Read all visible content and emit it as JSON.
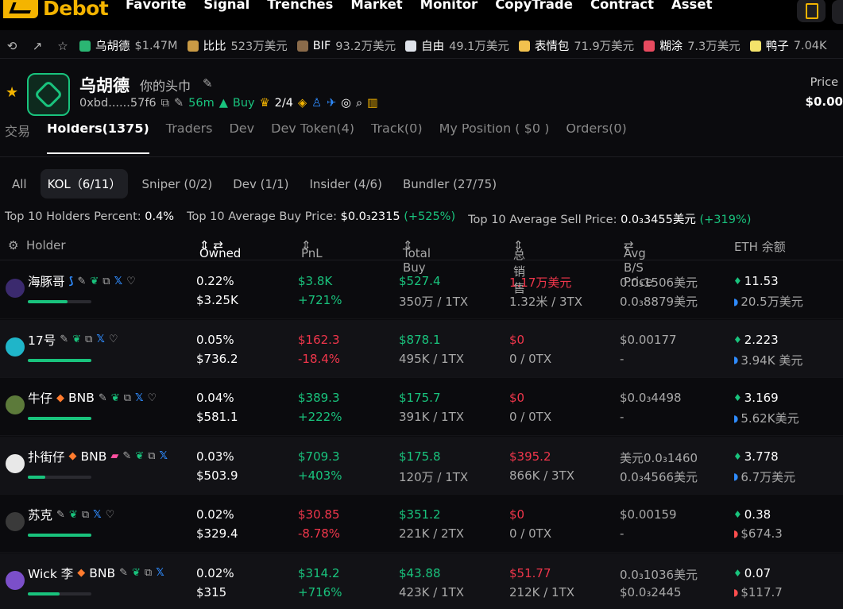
{
  "nav": {
    "logo": "Debot",
    "links": [
      "Favorite",
      "Signal",
      "Trenches",
      "Market",
      "Monitor",
      "CopyTrade",
      "Contract",
      "Asset"
    ]
  },
  "ticker": [
    {
      "name": "乌胡德",
      "value": "$1.47M",
      "color": "#2bb673"
    },
    {
      "name": "比比",
      "value": "523万美元",
      "color": "#c99a45"
    },
    {
      "name": "BIF",
      "value": "93.2万美元",
      "color": "#8a6b4a"
    },
    {
      "name": "自由",
      "value": "49.1万美元",
      "color": "#dfe3ea"
    },
    {
      "name": "表情包",
      "value": "71.9万美元",
      "color": "#f2c14e"
    },
    {
      "name": "糊涂",
      "value": "7.3万美元",
      "color": "#e84a5f"
    },
    {
      "name": "鸭子",
      "value": "7.04K",
      "color": "#f4e36b"
    }
  ],
  "token": {
    "name": "乌胡德",
    "subtitle": "你的头巾",
    "address": "0xbd......57f6",
    "age": "56m",
    "buy_label": "Buy",
    "ratio": "2/4",
    "price_label": "Price",
    "price_value": "$0.00"
  },
  "tabs": [
    "交易",
    "Holders(1375)",
    "Traders",
    "Dev",
    "Dev Token(4)",
    "Track(0)",
    "My Position ( $0 )",
    "Orders(0)"
  ],
  "filters": [
    "All",
    "KOL（6/11）",
    "Sniper (0/2)",
    "Dev (1/1)",
    "Insider (4/6)",
    "Bundler (27/75)"
  ],
  "stats": {
    "holders_percent_label": "Top 10 Holders Percent:",
    "holders_percent_value": "0.4%",
    "avg_buy_label": "Top 10 Average Buy Price:",
    "avg_buy_value": "$0.0₃2315",
    "avg_buy_change": "(+525%)",
    "avg_sell_label": "Top 10 Average Sell Price:",
    "avg_sell_value": "0.0₃3455美元",
    "avg_sell_change": "(+319%)"
  },
  "columns": {
    "holder": "Holder",
    "owned": "Owned",
    "pnl": "PnL",
    "total_buy": "Total Buy",
    "total_sell": "总销售",
    "avg_price": "Avg B/S Price",
    "eth_balance": "ETH 余额"
  },
  "holders": [
    {
      "name": "海豚哥",
      "tag": "",
      "avatar_color": "#3b2a6e",
      "bar": 0.62,
      "owned_pct": "0.22%",
      "owned_usd": "$3.25K",
      "pnl": "$3.8K",
      "pnl_pct": "+721%",
      "pnl_sign": "pos",
      "buy": "$527.4",
      "buy_detail": "350万 / 1TX",
      "sell": "1.17万美元",
      "sell_detail": "1.32米 / 3TX",
      "sell_sign": "pos",
      "avg_buy": "0.0₃1506美元",
      "avg_sell": "0.0₃8879美元",
      "eth": "11.53",
      "usd_balance": "20.5万美元"
    },
    {
      "name": "17号",
      "tag": "",
      "avatar_color": "#1fb5c9",
      "bar": 1.0,
      "owned_pct": "0.05%",
      "owned_usd": "$736.2",
      "pnl": "$162.3",
      "pnl_pct": "-18.4%",
      "pnl_sign": "neg",
      "buy": "$878.1",
      "buy_detail": "495K / 1TX",
      "sell": "$0",
      "sell_detail": "0 / 0TX",
      "sell_sign": "pos",
      "avg_buy": "$0.00177",
      "avg_sell": "-",
      "eth": "2.223",
      "usd_balance": "3.94K 美元"
    },
    {
      "name": "牛仔",
      "tag": "BNB",
      "avatar_color": "#5c7a3a",
      "bar": 1.0,
      "owned_pct": "0.04%",
      "owned_usd": "$581.1",
      "pnl": "$389.3",
      "pnl_pct": "+222%",
      "pnl_sign": "pos",
      "buy": "$175.7",
      "buy_detail": "391K / 1TX",
      "sell": "$0",
      "sell_detail": "0 / 0TX",
      "sell_sign": "pos",
      "avg_buy": "$0.0₃4498",
      "avg_sell": "-",
      "eth": "3.169",
      "usd_balance": "5.62K美元"
    },
    {
      "name": "扑街仔",
      "tag": "BNB",
      "avatar_color": "#e8e8e8",
      "bar": 0.28,
      "owned_pct": "0.03%",
      "owned_usd": "$503.9",
      "pnl": "$709.3",
      "pnl_pct": "+403%",
      "pnl_sign": "pos",
      "buy": "$175.8",
      "buy_detail": "120万 / 1TX",
      "sell": "$395.2",
      "sell_detail": "866K / 3TX",
      "sell_sign": "pos",
      "avg_buy": "美元0.0₃1460",
      "avg_sell": "0.0₃4566美元",
      "eth": "3.778",
      "usd_balance": "6.7万美元"
    },
    {
      "name": "苏克",
      "tag": "",
      "avatar_color": "#3a3a3a",
      "bar": 1.0,
      "owned_pct": "0.02%",
      "owned_usd": "$329.4",
      "pnl": "$30.85",
      "pnl_pct": "-8.78%",
      "pnl_sign": "neg",
      "buy": "$351.2",
      "buy_detail": "221K / 2TX",
      "sell": "$0",
      "sell_detail": "0 / 0TX",
      "sell_sign": "pos",
      "avg_buy": "$0.00159",
      "avg_sell": "-",
      "eth": "0.38",
      "usd_balance": "$674.3"
    },
    {
      "name": "Wick 李",
      "tag": "BNB",
      "avatar_color": "#7b4fc9",
      "bar": 0.5,
      "owned_pct": "0.02%",
      "owned_usd": "$315",
      "pnl": "$314.2",
      "pnl_pct": "+716%",
      "pnl_sign": "pos",
      "buy": "$43.88",
      "buy_detail": "423K / 1TX",
      "sell": "$51.77",
      "sell_detail": "212K / 1TX",
      "sell_sign": "pos",
      "avg_buy": "0.0₃1036美元",
      "avg_sell": "$0.0₃2445",
      "eth": "0.07",
      "usd_balance": "$117.7"
    }
  ]
}
